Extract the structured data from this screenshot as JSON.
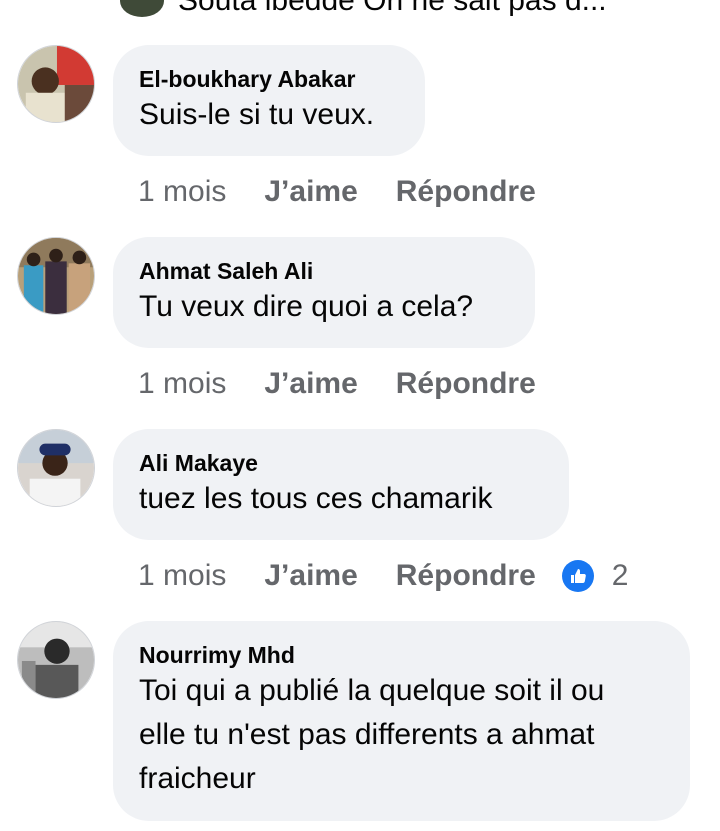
{
  "top_partial": {
    "text": "Souta ibedde  On ne sait pas d..."
  },
  "comments": [
    {
      "author": "El-boukhary Abakar",
      "text": "Suis-le si tu veux.",
      "time": "1 mois",
      "like_label": "J’aime",
      "reply_label": "Répondre"
    },
    {
      "author": "Ahmat Saleh Ali",
      "text": "Tu veux dire quoi a cela?",
      "time": "1 mois",
      "like_label": "J’aime",
      "reply_label": "Répondre"
    },
    {
      "author": "Ali Makaye",
      "text": "tuez les tous ces chamarik",
      "time": "1 mois",
      "like_label": "J’aime",
      "reply_label": "Répondre",
      "reaction_icon": "like-icon",
      "reaction_count": "2"
    },
    {
      "author": "Nourrimy Mhd",
      "text_lines": [
        "Toi qui a publié la quelque soit il ou",
        "elle tu n'est pas differents a ahmat",
        "fraicheur"
      ]
    }
  ],
  "colors": {
    "bubble_bg": "#f0f2f5",
    "meta_text": "#65676b",
    "like_blue": "#1877f2"
  }
}
